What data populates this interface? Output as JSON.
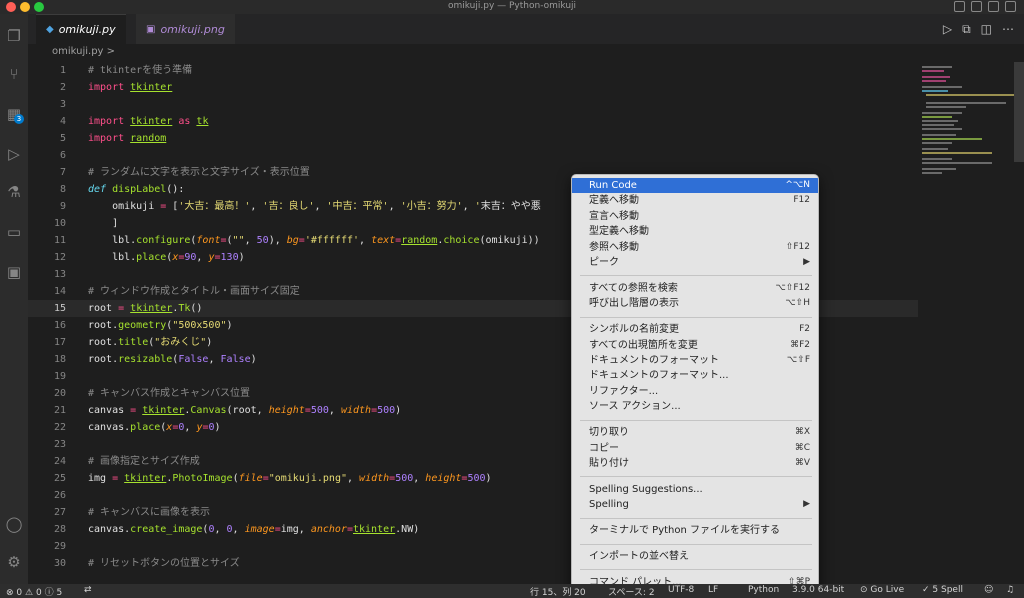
{
  "window": {
    "title": "omikuji.py — Python-omikuji"
  },
  "tabs": [
    {
      "label": "omikuji.py",
      "icon": "python-file-icon"
    },
    {
      "label": "omikuji.png",
      "icon": "image-file-icon"
    }
  ],
  "breadcrumb": {
    "file": "omikuji.py",
    "sep": ">"
  },
  "activity": {
    "extensions_badge": "3"
  },
  "code_lines": [
    {
      "n": "1",
      "t": "# tkinterを使う準備"
    },
    {
      "n": "2",
      "t": "import tkinter"
    },
    {
      "n": "3",
      "t": ""
    },
    {
      "n": "4",
      "t": "import tkinter as tk"
    },
    {
      "n": "5",
      "t": "import random"
    },
    {
      "n": "6",
      "t": ""
    },
    {
      "n": "7",
      "t": "# ランダムに文字を表示と文字サイズ・表示位置"
    },
    {
      "n": "8",
      "t": "def dispLabel():"
    },
    {
      "n": "9",
      "t": "    omikuji = ['大吉：最高！', '吉：良し', '中吉：平常', '小吉：努力', '末吉：やや悪"
    },
    {
      "n": "10",
      "t": "    ]"
    },
    {
      "n": "11",
      "t": "    lbl.configure(font=(\"\", 50), bg='#ffffff', text=random.choice(omikuji))"
    },
    {
      "n": "12",
      "t": "    lbl.place(x=90, y=130)"
    },
    {
      "n": "13",
      "t": ""
    },
    {
      "n": "14",
      "t": "# ウィンドウ作成とタイトル・画面サイズ固定"
    },
    {
      "n": "15",
      "t": "root = tkinter.Tk()"
    },
    {
      "n": "16",
      "t": "root.geometry(\"500x500\")"
    },
    {
      "n": "17",
      "t": "root.title(\"おみくじ\")"
    },
    {
      "n": "18",
      "t": "root.resizable(False, False)"
    },
    {
      "n": "19",
      "t": ""
    },
    {
      "n": "20",
      "t": "# キャンバス作成とキャンバス位置"
    },
    {
      "n": "21",
      "t": "canvas = tkinter.Canvas(root, height=500, width=500)"
    },
    {
      "n": "22",
      "t": "canvas.place(x=0, y=0)"
    },
    {
      "n": "23",
      "t": ""
    },
    {
      "n": "24",
      "t": "# 画像指定とサイズ作成"
    },
    {
      "n": "25",
      "t": "img = tkinter.PhotoImage(file=\"omikuji.png\", width=500, height=500)"
    },
    {
      "n": "26",
      "t": ""
    },
    {
      "n": "27",
      "t": "# キャンバスに画像を表示"
    },
    {
      "n": "28",
      "t": "canvas.create_image(0, 0, image=img, anchor=tkinter.NW)"
    },
    {
      "n": "29",
      "t": ""
    },
    {
      "n": "30",
      "t": "# リセットボタンの位置とサイズ"
    }
  ],
  "current_line": "15",
  "context_menu": {
    "items": [
      {
        "label": "Run Code",
        "shortcut": "^⌥N"
      },
      {
        "label": "定義へ移動",
        "shortcut": "F12"
      },
      {
        "label": "宣言へ移動",
        "shortcut": ""
      },
      {
        "label": "型定義へ移動",
        "shortcut": ""
      },
      {
        "label": "参照へ移動",
        "shortcut": "⇧F12"
      },
      {
        "label": "ピーク",
        "shortcut": "▶"
      },
      {
        "label": "すべての参照を検索",
        "shortcut": "⌥⇧F12"
      },
      {
        "label": "呼び出し階層の表示",
        "shortcut": "⌥⇧H"
      },
      {
        "label": "シンボルの名前変更",
        "shortcut": "F2"
      },
      {
        "label": "すべての出現箇所を変更",
        "shortcut": "⌘F2"
      },
      {
        "label": "ドキュメントのフォーマット",
        "shortcut": "⌥⇧F"
      },
      {
        "label": "ドキュメントのフォーマット...",
        "shortcut": ""
      },
      {
        "label": "リファクター...",
        "shortcut": ""
      },
      {
        "label": "ソース アクション...",
        "shortcut": ""
      },
      {
        "label": "切り取り",
        "shortcut": "⌘X"
      },
      {
        "label": "コピー",
        "shortcut": "⌘C"
      },
      {
        "label": "貼り付け",
        "shortcut": "⌘V"
      },
      {
        "label": "Spelling Suggestions...",
        "shortcut": ""
      },
      {
        "label": "Spelling",
        "shortcut": "▶"
      },
      {
        "label": "ターミナルで Python ファイルを実行する",
        "shortcut": ""
      },
      {
        "label": "インポートの並べ替え",
        "shortcut": ""
      },
      {
        "label": "コマンド パレット...",
        "shortcut": "⇧⌘P"
      }
    ]
  },
  "statusbar": {
    "errors": "0",
    "warnings": "0",
    "infos": "0",
    "info_count2": "5",
    "cursor": "行 15、列 20",
    "spaces": "スペース: 2",
    "encoding": "UTF-8",
    "eol": "LF",
    "language": "Python",
    "interpreter": "3.9.0 64-bit",
    "golive": "Go Live",
    "spell": "5 Spell"
  },
  "colors": {
    "accent": "#2f6fd6",
    "badge": "#007acc",
    "keyword": "#ff4f8b",
    "module": "#a6e22e"
  }
}
